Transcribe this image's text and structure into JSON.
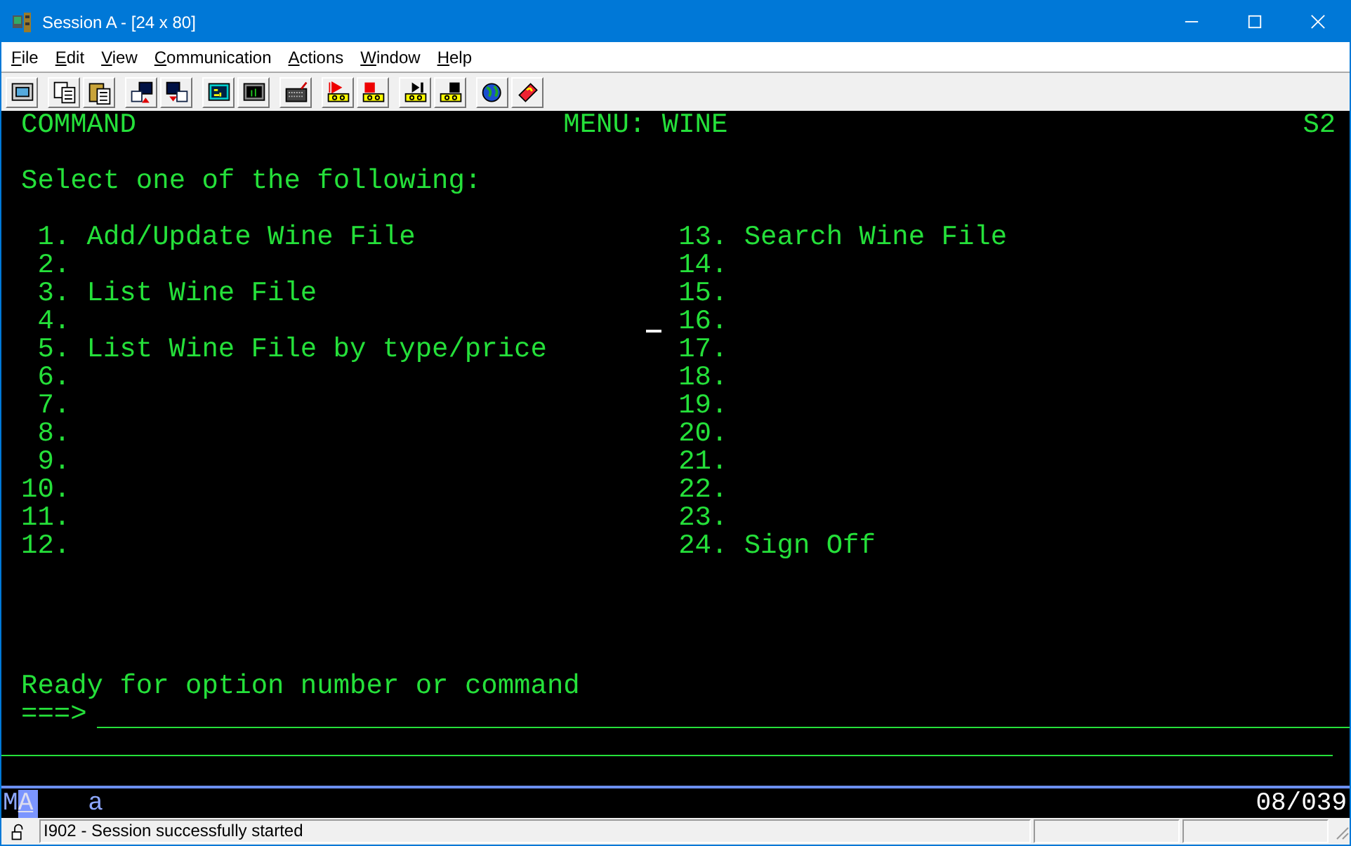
{
  "window": {
    "title": "Session A - [24 x 80]"
  },
  "menu": [
    "File",
    "Edit",
    "View",
    "Communication",
    "Actions",
    "Window",
    "Help"
  ],
  "screen": {
    "header": {
      "left": "COMMAND",
      "center": "MENU: WINE",
      "right": "S2"
    },
    "instruction": "Select one of the following:",
    "options_left": [
      {
        "number": "1.",
        "label": "Add/Update Wine File"
      },
      {
        "number": "2."
      },
      {
        "number": "3.",
        "label": "List Wine File"
      },
      {
        "number": "4."
      },
      {
        "number": "5.",
        "label": "List Wine File by type/price"
      },
      {
        "number": "6."
      },
      {
        "number": "7."
      },
      {
        "number": "8."
      },
      {
        "number": "9."
      },
      {
        "number": "10."
      },
      {
        "number": "11."
      },
      {
        "number": "12."
      }
    ],
    "options_right": [
      {
        "number": "13.",
        "label": "Search Wine File"
      },
      {
        "number": "14."
      },
      {
        "number": "15."
      },
      {
        "number": "16."
      },
      {
        "number": "17."
      },
      {
        "number": "18."
      },
      {
        "number": "19."
      },
      {
        "number": "20."
      },
      {
        "number": "21."
      },
      {
        "number": "22."
      },
      {
        "number": "23."
      },
      {
        "number": "24.",
        "label": "Sign Off"
      }
    ],
    "message": "Ready for option number or command",
    "prompt": "===>"
  },
  "oia": {
    "mode": "M",
    "status": "A",
    "input": "a",
    "cursor_position": "08/039"
  },
  "status_bar": {
    "message": "I902 - Session successfully started"
  }
}
